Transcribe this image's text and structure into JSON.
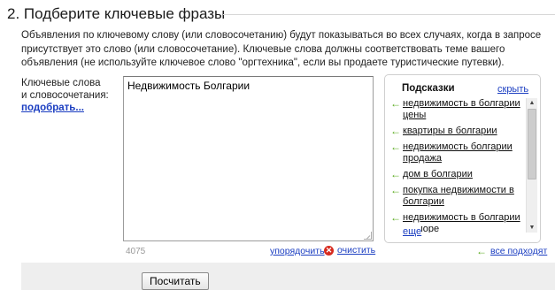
{
  "section": {
    "title": "2. Подберите ключевые фразы",
    "description": "Объявления по ключевому слову (или словосочетанию) будут показываться во всех случаях, когда в запросе присутствует это слово (или словосочетание). Ключевые слова должны соответствовать теме вашего объявления (не используйте ключевое слово \"оргтехника\", если вы продаете туристические путевки)."
  },
  "keywords": {
    "label_line1": "Ключевые слова",
    "label_line2": "и словосочетания:",
    "pick_link": "подобрать...",
    "value": "Недвижимость Болгарии",
    "char_count": "4075",
    "sort_link": "упорядочить",
    "clear_link": "очистить"
  },
  "hints": {
    "title": "Подсказки",
    "hide_link": "скрыть",
    "items": [
      "недвижимость в болгарии цены",
      "квартиры в болгарии",
      "недвижимость болгарии продажа",
      "дом в болгарии",
      "покупка недвижимости в болгарии",
      "недвижимость в болгарии на море"
    ],
    "more_link": "еще",
    "all_fit_link": "все подходят"
  },
  "actions": {
    "calculate": "Посчитать"
  },
  "icons": {
    "add_arrow": "left-arrow-icon",
    "clear": "clear-x-icon"
  },
  "colors": {
    "link": "#1a3dc1",
    "arrow": "#5aab1e",
    "clear_icon": "#d72b1f",
    "bar_bg": "#eeeeee"
  }
}
